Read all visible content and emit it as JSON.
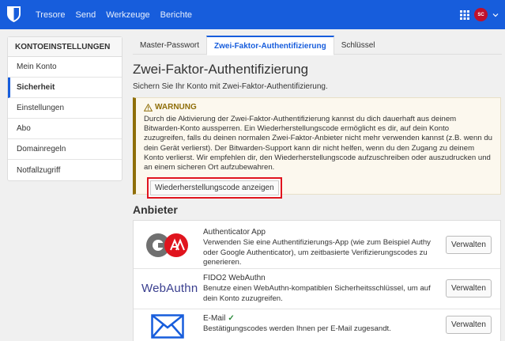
{
  "nav": {
    "links": [
      "Tresore",
      "Send",
      "Werkzeuge",
      "Berichte"
    ],
    "avatar_initials": "SC",
    "brand_color": "#175ddc"
  },
  "sidebar": {
    "header": "KONTOEINSTELLUNGEN",
    "items": [
      {
        "label": "Mein Konto"
      },
      {
        "label": "Sicherheit"
      },
      {
        "label": "Einstellungen"
      },
      {
        "label": "Abo"
      },
      {
        "label": "Domainregeln"
      },
      {
        "label": "Notfallzugriff"
      }
    ],
    "active": "Sicherheit"
  },
  "tabs": [
    "Master-Passwort",
    "Zwei-Faktor-Authentifizierung",
    "Schlüssel"
  ],
  "active_tab": "Zwei-Faktor-Authentifizierung",
  "page": {
    "title": "Zwei-Faktor-Authentifizierung",
    "subtitle": "Sichern Sie Ihr Konto mit Zwei-Faktor-Authentifizierung."
  },
  "warning": {
    "title": "WARNUNG",
    "text": "Durch die Aktivierung der Zwei-Faktor-Authentifizierung kannst du dich dauerhaft aus deinem Bitwarden-Konto aussperren. Ein Wiederherstellungscode ermöglicht es dir, auf dein Konto zuzugreifen, falls du deinen normalen Zwei-Faktor-Anbieter nicht mehr verwenden kannst (z.B. wenn du dein Gerät verlierst). Der Bitwarden-Support kann dir nicht helfen, wenn du den Zugang zu deinem Konto verlierst. Wir empfehlen dir, den Wiederherstellungscode aufzuschreiben oder auszudrucken und an einem sicheren Ort aufzubewahren.",
    "button": "Wiederherstellungscode anzeigen"
  },
  "providers": {
    "title": "Anbieter",
    "items": [
      {
        "name": "Authenticator App",
        "description": "Verwenden Sie eine Authentifizierungs-App (wie zum Beispiel Authy oder Google Authenticator), um zeitbasierte Verifizierungscodes zu generieren.",
        "button": "Verwalten",
        "icon": "authenticator-app-icon"
      },
      {
        "name": "FIDO2 WebAuthn",
        "description": "Benutze einen WebAuthn-kompatiblen Sicherheitsschlüssel, um auf dein Konto zuzugreifen.",
        "button": "Verwalten",
        "icon": "webauthn-logo",
        "logo_text": "WebAuthn"
      },
      {
        "name": "E-Mail",
        "description": "Bestätigungscodes werden Ihnen per E-Mail zugesandt.",
        "button": "Verwalten",
        "icon": "email-icon",
        "enabled": true
      }
    ]
  }
}
